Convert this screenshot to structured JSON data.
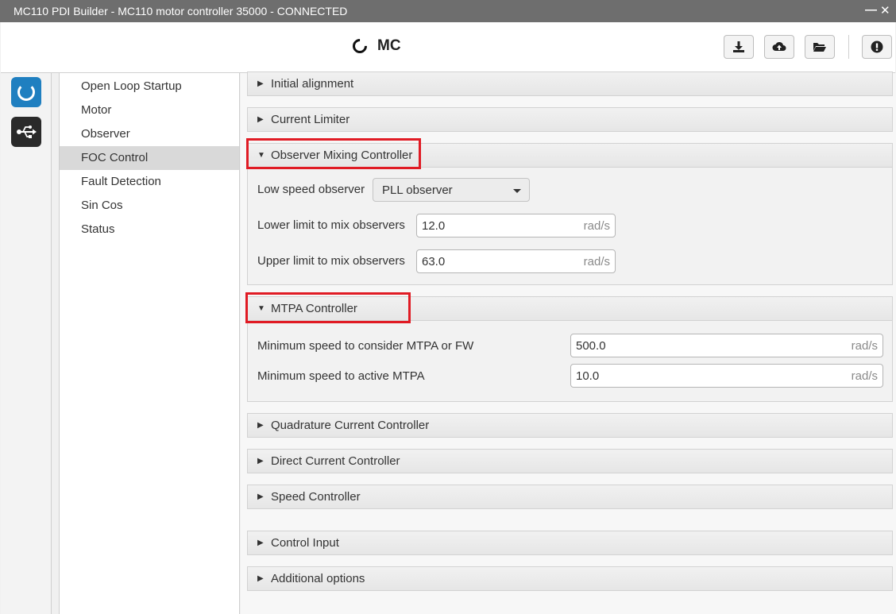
{
  "window": {
    "title": "MC110 PDI Builder - MC110 motor controller 35000 - CONNECTED",
    "minimize": "—",
    "close": "✕"
  },
  "header": {
    "app_name": "MC"
  },
  "toolbar": {
    "icons": [
      "download-icon",
      "cloud-upload-icon",
      "folder-open-icon",
      "info-icon"
    ]
  },
  "sidebar": {
    "icons": [
      "mc-logo-icon",
      "usb-icon"
    ],
    "accent": "#1f7fc0"
  },
  "nav": {
    "items": [
      "Open Loop Startup",
      "Motor",
      "Observer",
      "FOC Control",
      "Fault Detection",
      "Sin Cos",
      "Status"
    ],
    "selected": "FOC Control"
  },
  "sections": {
    "initial_alignment": {
      "title": "Initial alignment",
      "expanded": false
    },
    "current_limiter": {
      "title": "Current Limiter",
      "expanded": false
    },
    "observer_mixing": {
      "title": "Observer Mixing Controller",
      "expanded": true,
      "low_speed_label": "Low speed observer",
      "low_speed_value": "PLL observer",
      "lower_limit_label": "Lower limit to mix observers",
      "lower_limit_value": "12.0",
      "lower_limit_unit": "rad/s",
      "upper_limit_label": "Upper limit to mix observers",
      "upper_limit_value": "63.0",
      "upper_limit_unit": "rad/s"
    },
    "mtpa": {
      "title": "MTPA Controller",
      "expanded": true,
      "min_speed_fw_label": "Minimum speed to consider MTPA or FW",
      "min_speed_fw_value": "500.0",
      "min_speed_fw_unit": "rad/s",
      "min_speed_active_label": "Minimum speed to active MTPA",
      "min_speed_active_value": "10.0",
      "min_speed_active_unit": "rad/s"
    },
    "quadrature": {
      "title": "Quadrature Current Controller",
      "expanded": false
    },
    "direct": {
      "title": "Direct Current Controller",
      "expanded": false
    },
    "speed": {
      "title": "Speed Controller",
      "expanded": false
    },
    "control_input": {
      "title": "Control Input",
      "expanded": false
    },
    "additional": {
      "title": "Additional options",
      "expanded": false
    }
  },
  "highlight_color": "#e01b24"
}
